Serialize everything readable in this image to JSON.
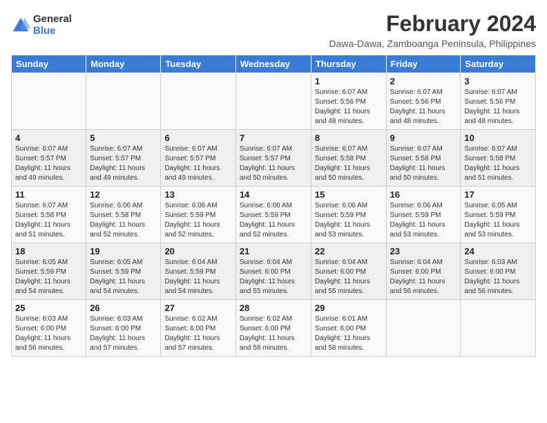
{
  "logo": {
    "general": "General",
    "blue": "Blue"
  },
  "title": "February 2024",
  "subtitle": "Dawa-Dawa, Zamboanga Peninsula, Philippines",
  "headers": [
    "Sunday",
    "Monday",
    "Tuesday",
    "Wednesday",
    "Thursday",
    "Friday",
    "Saturday"
  ],
  "weeks": [
    [
      {
        "day": "",
        "info": ""
      },
      {
        "day": "",
        "info": ""
      },
      {
        "day": "",
        "info": ""
      },
      {
        "day": "",
        "info": ""
      },
      {
        "day": "1",
        "info": "Sunrise: 6:07 AM\nSunset: 5:56 PM\nDaylight: 11 hours and 48 minutes."
      },
      {
        "day": "2",
        "info": "Sunrise: 6:07 AM\nSunset: 5:56 PM\nDaylight: 11 hours and 48 minutes."
      },
      {
        "day": "3",
        "info": "Sunrise: 6:07 AM\nSunset: 5:56 PM\nDaylight: 11 hours and 48 minutes."
      }
    ],
    [
      {
        "day": "4",
        "info": "Sunrise: 6:07 AM\nSunset: 5:57 PM\nDaylight: 11 hours and 49 minutes."
      },
      {
        "day": "5",
        "info": "Sunrise: 6:07 AM\nSunset: 5:57 PM\nDaylight: 11 hours and 49 minutes."
      },
      {
        "day": "6",
        "info": "Sunrise: 6:07 AM\nSunset: 5:57 PM\nDaylight: 11 hours and 49 minutes."
      },
      {
        "day": "7",
        "info": "Sunrise: 6:07 AM\nSunset: 5:57 PM\nDaylight: 11 hours and 50 minutes."
      },
      {
        "day": "8",
        "info": "Sunrise: 6:07 AM\nSunset: 5:58 PM\nDaylight: 11 hours and 50 minutes."
      },
      {
        "day": "9",
        "info": "Sunrise: 6:07 AM\nSunset: 5:58 PM\nDaylight: 11 hours and 50 minutes."
      },
      {
        "day": "10",
        "info": "Sunrise: 6:07 AM\nSunset: 5:58 PM\nDaylight: 11 hours and 51 minutes."
      }
    ],
    [
      {
        "day": "11",
        "info": "Sunrise: 6:07 AM\nSunset: 5:58 PM\nDaylight: 11 hours and 51 minutes."
      },
      {
        "day": "12",
        "info": "Sunrise: 6:06 AM\nSunset: 5:58 PM\nDaylight: 11 hours and 52 minutes."
      },
      {
        "day": "13",
        "info": "Sunrise: 6:06 AM\nSunset: 5:59 PM\nDaylight: 11 hours and 52 minutes."
      },
      {
        "day": "14",
        "info": "Sunrise: 6:06 AM\nSunset: 5:59 PM\nDaylight: 11 hours and 52 minutes."
      },
      {
        "day": "15",
        "info": "Sunrise: 6:06 AM\nSunset: 5:59 PM\nDaylight: 11 hours and 53 minutes."
      },
      {
        "day": "16",
        "info": "Sunrise: 6:06 AM\nSunset: 5:59 PM\nDaylight: 11 hours and 53 minutes."
      },
      {
        "day": "17",
        "info": "Sunrise: 6:05 AM\nSunset: 5:59 PM\nDaylight: 11 hours and 53 minutes."
      }
    ],
    [
      {
        "day": "18",
        "info": "Sunrise: 6:05 AM\nSunset: 5:59 PM\nDaylight: 11 hours and 54 minutes."
      },
      {
        "day": "19",
        "info": "Sunrise: 6:05 AM\nSunset: 5:59 PM\nDaylight: 11 hours and 54 minutes."
      },
      {
        "day": "20",
        "info": "Sunrise: 6:04 AM\nSunset: 5:59 PM\nDaylight: 11 hours and 54 minutes."
      },
      {
        "day": "21",
        "info": "Sunrise: 6:04 AM\nSunset: 6:00 PM\nDaylight: 11 hours and 55 minutes."
      },
      {
        "day": "22",
        "info": "Sunrise: 6:04 AM\nSunset: 6:00 PM\nDaylight: 11 hours and 55 minutes."
      },
      {
        "day": "23",
        "info": "Sunrise: 6:04 AM\nSunset: 6:00 PM\nDaylight: 11 hours and 56 minutes."
      },
      {
        "day": "24",
        "info": "Sunrise: 6:03 AM\nSunset: 6:00 PM\nDaylight: 11 hours and 56 minutes."
      }
    ],
    [
      {
        "day": "25",
        "info": "Sunrise: 6:03 AM\nSunset: 6:00 PM\nDaylight: 11 hours and 56 minutes."
      },
      {
        "day": "26",
        "info": "Sunrise: 6:03 AM\nSunset: 6:00 PM\nDaylight: 11 hours and 57 minutes."
      },
      {
        "day": "27",
        "info": "Sunrise: 6:02 AM\nSunset: 6:00 PM\nDaylight: 11 hours and 57 minutes."
      },
      {
        "day": "28",
        "info": "Sunrise: 6:02 AM\nSunset: 6:00 PM\nDaylight: 11 hours and 58 minutes."
      },
      {
        "day": "29",
        "info": "Sunrise: 6:01 AM\nSunset: 6:00 PM\nDaylight: 11 hours and 58 minutes."
      },
      {
        "day": "",
        "info": ""
      },
      {
        "day": "",
        "info": ""
      }
    ]
  ]
}
